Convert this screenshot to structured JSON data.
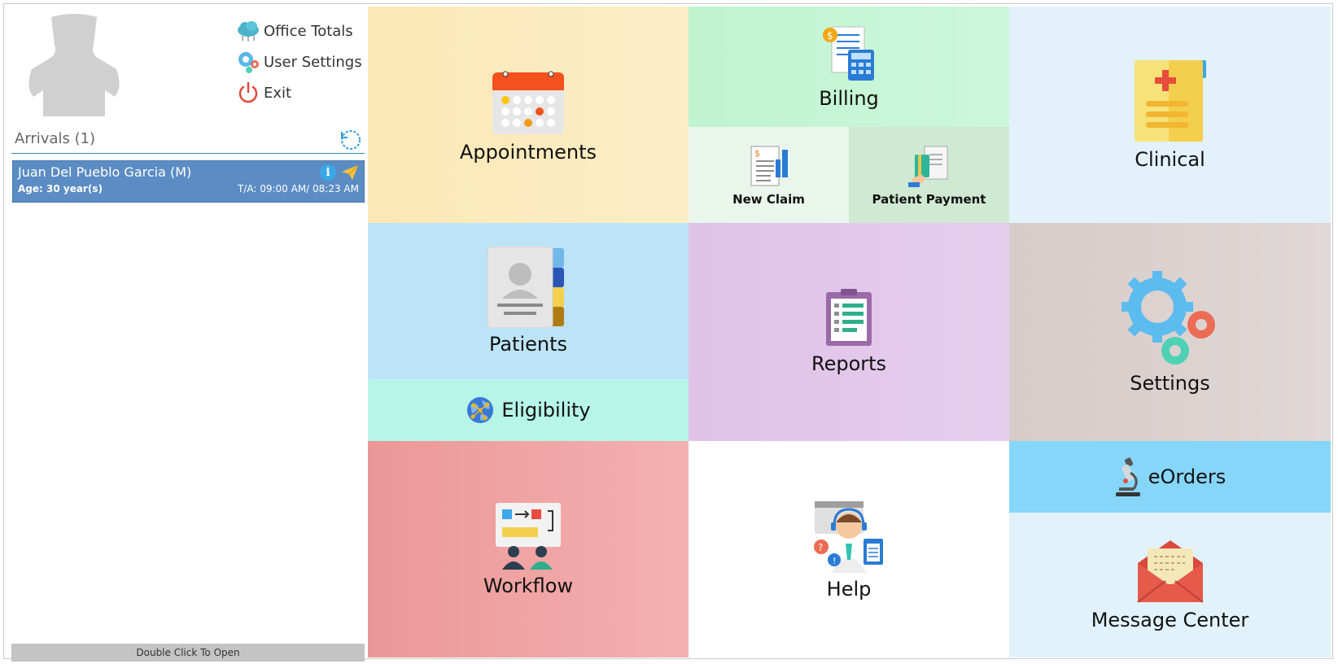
{
  "left": {
    "menu": {
      "office_totals": "Office Totals",
      "user_settings": "User Settings",
      "exit": "Exit"
    },
    "arrivals": {
      "title": "Arrivals (1)",
      "items": [
        {
          "name": "Juan Del Pueblo Garcia (M)",
          "age": "Age: 30 year(s)",
          "ta": "T/A: 09:00 AM/ 08:23 AM"
        }
      ]
    },
    "footer": "Double Click To Open"
  },
  "tiles": {
    "appointments": "Appointments",
    "billing": "Billing",
    "new_claim": "New Claim",
    "patient_payment": "Patient Payment",
    "clinical": "Clinical",
    "patients": "Patients",
    "eligibility": "Eligibility",
    "reports": "Reports",
    "settings": "Settings",
    "workflow": "Workflow",
    "help": "Help",
    "eorders": "eOrders",
    "message_center": "Message Center"
  },
  "colors": {
    "appointments": "#fbeab9",
    "billing": "#c5f5d5",
    "new_claim": "#eaf6ec",
    "patient_payment": "#cfe9d2",
    "clinical": "#e3f1fb",
    "patients": "#bde4f6",
    "eligibility": "#b6f5e7",
    "reports": "#e2c6ea",
    "settings": "#dcd2cf",
    "workflow": "#efa3a3",
    "help": "#ffffff",
    "eorders": "#86d6fa",
    "message_center": "#e1f2fb",
    "arrival_card": "#5b8cc4"
  }
}
